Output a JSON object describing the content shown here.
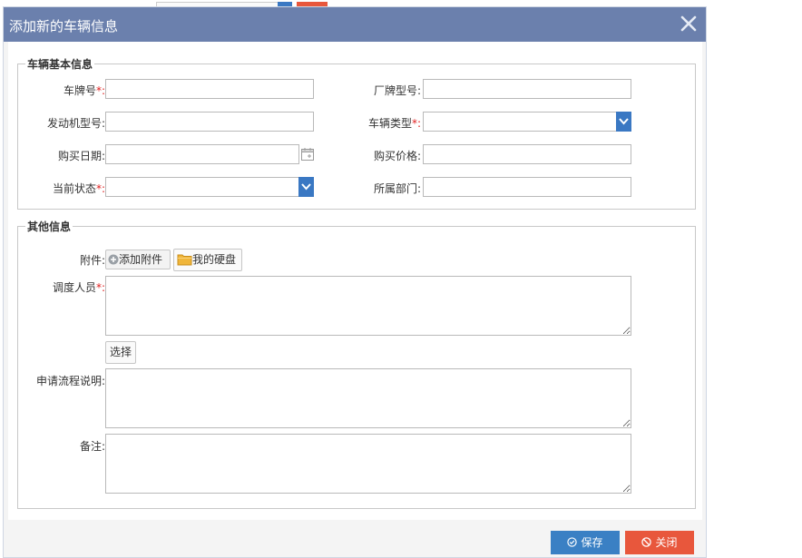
{
  "dialog": {
    "title": "添加新的车辆信息"
  },
  "basic": {
    "legend": "车辆基本信息",
    "plate_label": "车牌号",
    "model_label": "厂牌型号:",
    "engine_label": "发动机型号:",
    "type_label": "车辆类型",
    "buy_date_label": "购买日期:",
    "price_label": "购买价格:",
    "status_label": "当前状态",
    "dept_label": "所属部门:",
    "required_mark": "*:",
    "plate_value": "",
    "model_value": "",
    "engine_value": "",
    "type_value": "",
    "buy_date_value": "",
    "price_value": "",
    "status_value": "",
    "dept_value": ""
  },
  "other": {
    "legend": "其他信息",
    "attach_label": "附件:",
    "add_attach": "添加附件",
    "my_disk": "我的硬盘",
    "dispatcher_label": "调度人员",
    "required_mark": "*:",
    "select_btn": "选择",
    "process_label": "申请流程说明:",
    "remark_label": "备注:",
    "dispatcher_value": "",
    "process_value": "",
    "remark_value": ""
  },
  "footer": {
    "save": "保存",
    "close": "关闭"
  },
  "colors": {
    "titlebar": "#6b80ad",
    "save": "#3a80c4",
    "close": "#e8573c",
    "select_arrow": "#3a78c3",
    "required": "#e02020"
  },
  "icons": [
    "close-icon",
    "chevron-down-icon",
    "calendar-icon",
    "plus-circle-icon",
    "folder-icon",
    "check-circle-icon",
    "ban-icon"
  ]
}
